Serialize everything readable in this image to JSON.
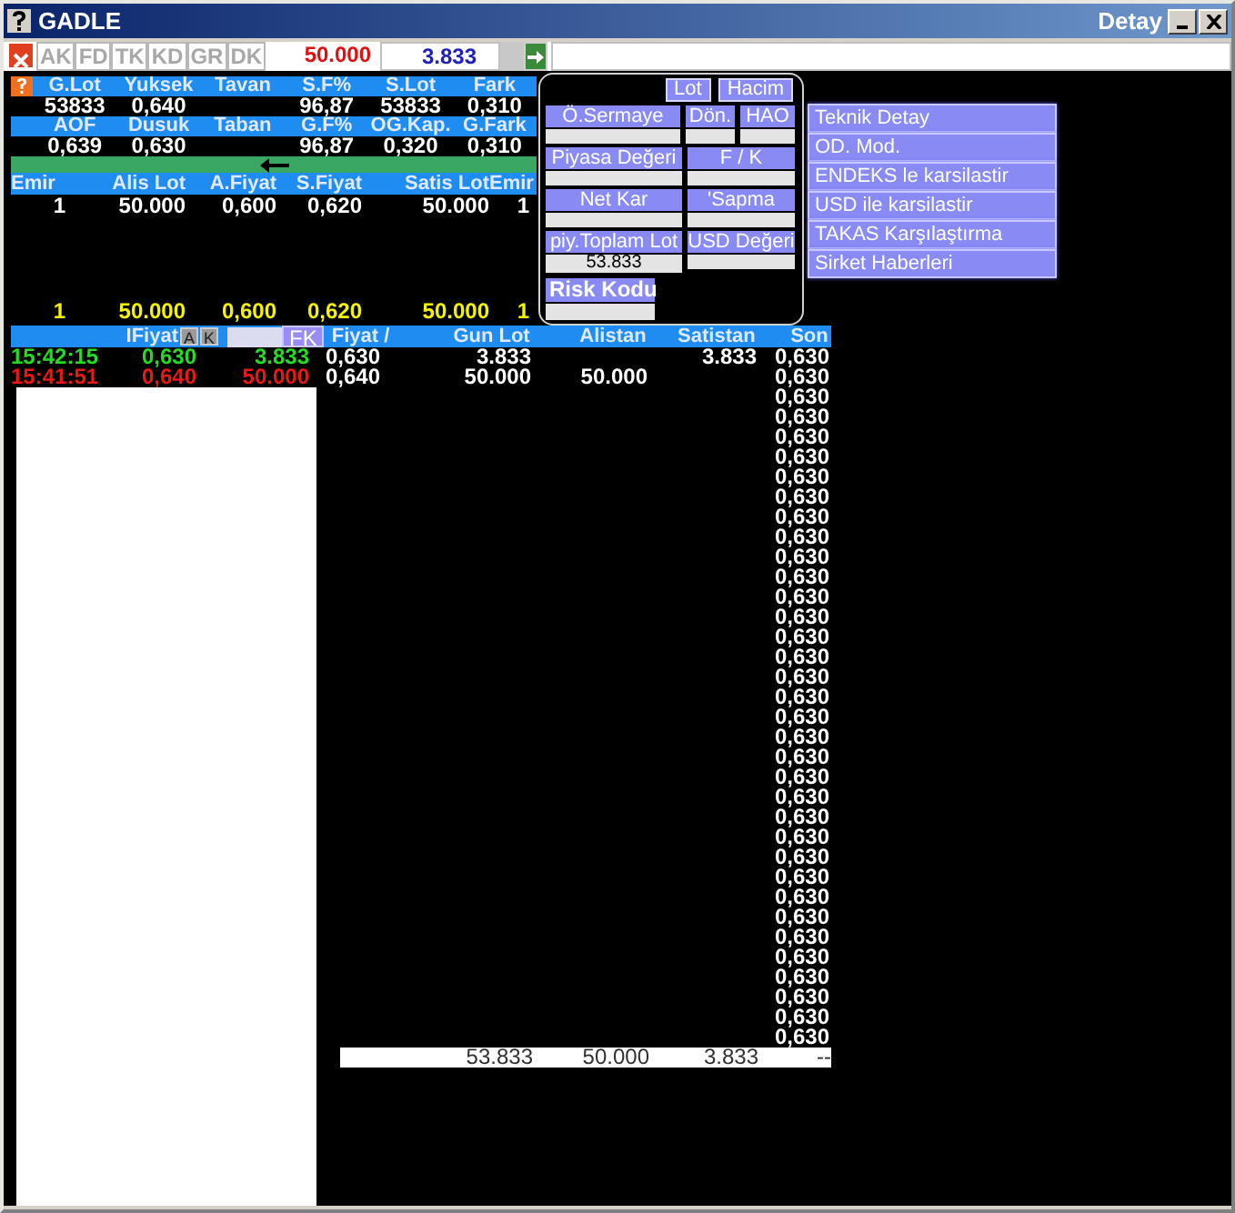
{
  "window": {
    "title": "GADLE",
    "caption_right": "Detay"
  },
  "toolbar": {
    "tabs": [
      {
        "label": "AK"
      },
      {
        "label": "FD"
      },
      {
        "label": "TK"
      },
      {
        "label": "KD"
      },
      {
        "label": "GR"
      },
      {
        "label": "DK"
      }
    ],
    "sell_amount": "50.000",
    "buy_amount": "3.833"
  },
  "stats_rows": [
    [
      {
        "label": "G.Lot",
        "value": "53833"
      },
      {
        "label": "Yuksek",
        "value": "0,640"
      },
      {
        "label": "Tavan"
      },
      {
        "label": "S.F%",
        "value": "96,87"
      },
      {
        "label": "S.Lot",
        "value": "53833"
      },
      {
        "label": "Fark",
        "value": "0,310"
      }
    ],
    [
      {
        "label": "AOF",
        "value": "0,639"
      },
      {
        "label": "Dusuk",
        "value": "0,630"
      },
      {
        "label": "Taban"
      },
      {
        "label": "G.F%",
        "value": "96,87"
      },
      {
        "label": "OG.Kap.",
        "value": "0,320"
      },
      {
        "label": "G.Fark",
        "value": "0,310"
      }
    ]
  ],
  "depth": {
    "columns": [
      "Emir",
      "Alis Lot",
      "A.Fiyat",
      "S.Fiyat",
      "Satis Lot",
      "Emir"
    ],
    "rows": [
      [
        "1",
        "50.000",
        "0,600",
        "0,620",
        "50.000",
        "1"
      ]
    ],
    "totals": [
      "1",
      "50.000",
      "0,600",
      "0,620",
      "50.000",
      "1"
    ]
  },
  "trades_header": {
    "price_label": "IFiyat",
    "buttons": [
      "A",
      "K"
    ],
    "fk": "FK"
  },
  "trades": [
    {
      "time": "15:42:15",
      "price": "0,630",
      "lot": "3.833",
      "color": "#22dd22"
    },
    {
      "time": "15:41:51",
      "price": "0,640",
      "lot": "50.000",
      "color": "#e81818"
    }
  ],
  "price_table": {
    "columns": [
      "Fiyat /",
      "Gun Lot",
      "Alistan",
      "Satistan",
      "Son"
    ],
    "rows": [
      {
        "fiyat": "0,630",
        "gun_lot": "3.833",
        "satistan": "3.833",
        "son": "0,630"
      },
      {
        "fiyat": "0,640",
        "gun_lot": "50.000",
        "alistan": "50.000",
        "son": "0,630"
      },
      {
        "son": "0,630"
      },
      {
        "son": "0,630"
      },
      {
        "son": "0,630"
      },
      {
        "son": "0,630"
      },
      {
        "son": "0,630"
      },
      {
        "son": "0,630"
      },
      {
        "son": "0,630"
      },
      {
        "son": "0,630"
      },
      {
        "son": "0,630"
      },
      {
        "son": "0,630"
      },
      {
        "son": "0,630"
      },
      {
        "son": "0,630"
      },
      {
        "son": "0,630"
      },
      {
        "son": "0,630"
      },
      {
        "son": "0,630"
      },
      {
        "son": "0,630"
      },
      {
        "son": "0,630"
      },
      {
        "son": "0,630"
      },
      {
        "son": "0,630"
      },
      {
        "son": "0,630"
      },
      {
        "son": "0,630"
      },
      {
        "son": "0,630"
      },
      {
        "son": "0,630"
      },
      {
        "son": "0,630"
      },
      {
        "son": "0,630"
      },
      {
        "son": "0,630"
      },
      {
        "son": "0,630"
      },
      {
        "son": "0,630"
      },
      {
        "son": "0,630"
      },
      {
        "son": "0,630"
      },
      {
        "son": "0,630"
      },
      {
        "son": "0,630"
      },
      {
        "son": "0,630"
      }
    ],
    "totals": {
      "gun_lot": "53.833",
      "alistan": "50.000",
      "satistan": "3.833",
      "son": "--"
    }
  },
  "detail_popup": {
    "buttons": [
      "Lot",
      "Hacim"
    ],
    "rows": [
      [
        {
          "label": "Ö.Sermaye"
        },
        {
          "label": "Dön."
        },
        {
          "label": "HAO"
        }
      ],
      [
        {
          "label": "Piyasa Değeri"
        },
        {
          "label": "F / K"
        }
      ],
      [
        {
          "label": "Net Kar"
        },
        {
          "label": "'Sapma"
        }
      ],
      [
        {
          "label": "piy.Toplam Lot",
          "value": "53.833"
        },
        {
          "label": "USD Değeri"
        }
      ]
    ],
    "risk_label": "Risk Kodu"
  },
  "menu": [
    "Teknik Detay",
    "OD. Mod.",
    "ENDEKS le karsilastir",
    "USD ile karsilastir",
    "TAKAS Karşılaştırma",
    "Sirket Haberleri"
  ]
}
